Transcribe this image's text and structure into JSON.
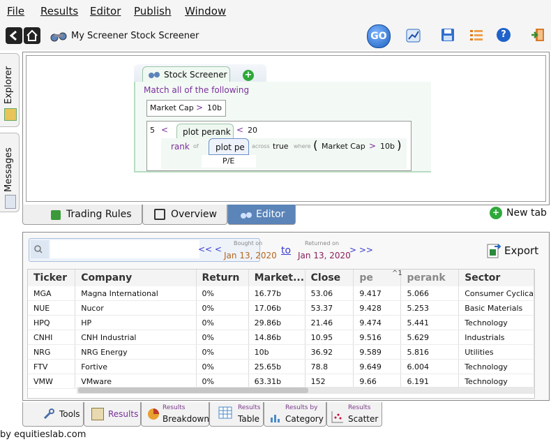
{
  "menu": [
    "File",
    "Results",
    "Editor",
    "Publish",
    "Window"
  ],
  "toolbar": {
    "title": "My Screener Stock Screener",
    "go_label": "GO"
  },
  "side_tabs": {
    "explorer": "Explorer",
    "messages": "Messages"
  },
  "editor": {
    "screener_tab": "Stock Screener",
    "match_text": "Match all of the following",
    "rule1": {
      "field": "Market Cap",
      "op": ">",
      "value": "10b"
    },
    "rule2": {
      "left_value": "5",
      "left_op": "<",
      "func": "plot perank",
      "right_op": "<",
      "right_value": "20",
      "rank_label": "rank",
      "of_label": "of",
      "inner_func": "plot pe",
      "across_label": "across",
      "true_label": "true",
      "where_label": "where",
      "open_paren": "(",
      "close_paren": ")",
      "cond_field": "Market Cap",
      "cond_op": ">",
      "cond_value": "10b",
      "inner_sub": "P/E"
    }
  },
  "top_tabs": [
    {
      "label": "Trading Rules"
    },
    {
      "label": "Overview"
    },
    {
      "label": "Editor"
    }
  ],
  "new_tab_label": "New tab",
  "results_bar": {
    "nav_prev": "<< <",
    "bought_label": "Bought on",
    "bought_date": "Jan 13, 2020",
    "to_label": "to",
    "returned_label": "Returned on",
    "returned_date": "Jan 13, 2020",
    "nav_next": "> >>",
    "export_label": "Export"
  },
  "table": {
    "columns": [
      "Ticker",
      "Company",
      "Return",
      "Market...",
      "Close",
      "pe",
      "perank",
      "Sector"
    ],
    "sort_marker": "^1",
    "rows": [
      [
        "MGA",
        "Magna International",
        "0%",
        "16.77b",
        "53.06",
        "9.417",
        "5.066",
        "Consumer Cyclica"
      ],
      [
        "NUE",
        "Nucor",
        "0%",
        "17.06b",
        "53.37",
        "9.428",
        "5.253",
        "Basic Materials"
      ],
      [
        "HPQ",
        "HP",
        "0%",
        "29.86b",
        "21.46",
        "9.474",
        "5.441",
        "Technology"
      ],
      [
        "CNHI",
        "CNH Industrial",
        "0%",
        "14.86b",
        "10.95",
        "9.516",
        "5.629",
        "Industrials"
      ],
      [
        "NRG",
        "NRG Energy",
        "0%",
        "10b",
        "36.92",
        "9.589",
        "5.816",
        "Utilities"
      ],
      [
        "FTV",
        "Fortive",
        "0%",
        "25.65b",
        "78.8",
        "9.649",
        "6.004",
        "Technology"
      ],
      [
        "VMW",
        "VMware",
        "0%",
        "63.31b",
        "152",
        "9.66",
        "6.191",
        "Technology"
      ]
    ]
  },
  "bottom_tabs": {
    "tools": "Tools",
    "results": "Results",
    "breakdown_small": "Results",
    "breakdown_big": "Breakdown",
    "table_small": "Results",
    "table_big": "Table",
    "category_small": "Results by",
    "category_big": "Category",
    "scatter_small": "Results",
    "scatter_big": "Scatter"
  },
  "footer": "by equitieslab.com",
  "colors": {
    "accent": "#5b84b8",
    "link": "#3a3ad0",
    "date": "#b5651d",
    "date2": "#8a1f5a",
    "green": "#2e9e2e"
  }
}
